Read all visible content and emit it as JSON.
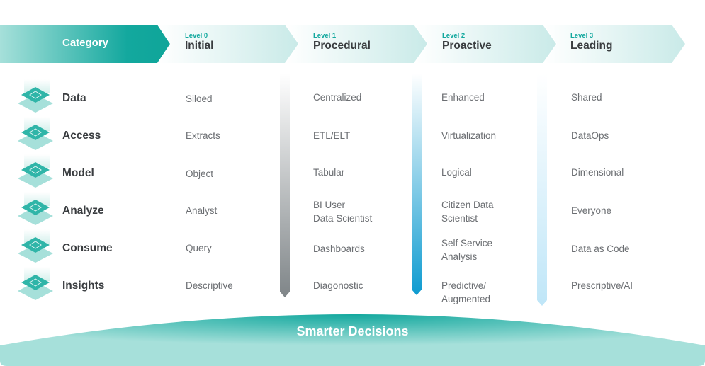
{
  "header": {
    "category_label": "Category",
    "levels": [
      {
        "number": "Level 0",
        "name": "Initial"
      },
      {
        "number": "Level 1",
        "name": "Procedural"
      },
      {
        "number": "Level 2",
        "name": "Proactive"
      },
      {
        "number": "Level 3",
        "name": "Leading"
      }
    ]
  },
  "categories": [
    {
      "label": "Data",
      "icon": "database-layer-icon",
      "values": [
        "Siloed",
        "Centralized",
        "Enhanced",
        "Shared"
      ]
    },
    {
      "label": "Access",
      "icon": "access-layer-icon",
      "values": [
        "Extracts",
        "ETL/ELT",
        "Virtualization",
        "DataOps"
      ]
    },
    {
      "label": "Model",
      "icon": "model-layer-icon",
      "values": [
        "Object",
        "Tabular",
        "Logical",
        "Dimensional"
      ]
    },
    {
      "label": "Analyze",
      "icon": "analyze-layer-icon",
      "values": [
        "Analyst",
        "BI User\nData Scientist",
        "Citizen Data\nScientist",
        "Everyone"
      ]
    },
    {
      "label": "Consume",
      "icon": "consume-layer-icon",
      "values": [
        "Query",
        "Dashboards",
        "Self Service\nAnalysis",
        "Data as Code"
      ]
    },
    {
      "label": "Insights",
      "icon": "insights-layer-icon",
      "values": [
        "Descriptive",
        "Diagonostic",
        "Predictive/\nAugmented",
        "Prescriptive/AI"
      ]
    }
  ],
  "footer": {
    "label": "Smarter Decisions"
  },
  "colors": {
    "teal": "#13a89e",
    "teal_light": "#a6e0da",
    "header_light": "#cdecea",
    "bar_gray": "#7f8588",
    "bar_blue": "#0e9bd0",
    "bar_lightblue": "#bfe6f8",
    "text_dark": "#3a3d40",
    "text_body": "#6b6e72"
  }
}
